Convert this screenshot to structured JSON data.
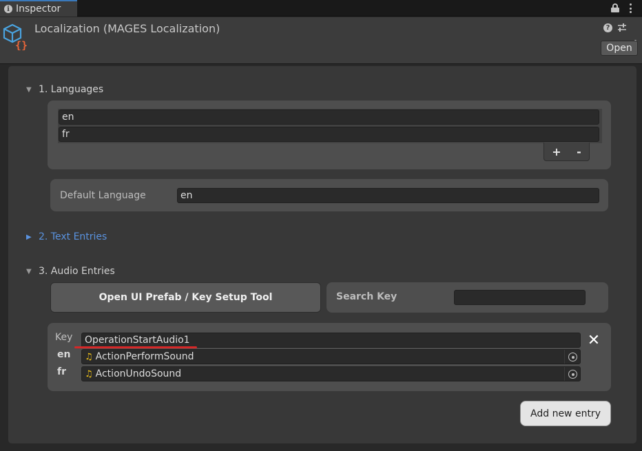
{
  "tab": {
    "title": "Inspector"
  },
  "header": {
    "object_title": "Localization (MAGES Localization)",
    "open_button": "Open",
    "help_glyph": "?"
  },
  "sections": {
    "languages": {
      "title": "1. Languages",
      "items": [
        "en",
        "fr"
      ],
      "add_glyph": "+",
      "remove_glyph": "-",
      "default_language_label": "Default Language",
      "default_language_value": "en"
    },
    "text_entries": {
      "title": "2. Text Entries"
    },
    "audio_entries": {
      "title": "3. Audio Entries",
      "open_tool_button": "Open UI Prefab / Key Setup Tool",
      "search_label": "Search Key",
      "search_value": "",
      "entry": {
        "key_label": "Key",
        "key_value": "OperationStartAudio1",
        "rows": [
          {
            "lang": "en",
            "value": "ActionPerformSound"
          },
          {
            "lang": "fr",
            "value": "ActionUndoSound"
          }
        ],
        "remove_glyph": "✕"
      },
      "add_entry_button": "Add new entry"
    }
  },
  "icons": {
    "tab": "info-icon",
    "lock": "lock-icon",
    "menu": "kebab-menu-icon",
    "object": "localization-cube-icon",
    "help": "help-icon",
    "preset": "preset-sliders-icon",
    "audio": "audio-clip-icon",
    "picker": "object-picker-icon"
  },
  "colors": {
    "accent_tab": "#3a79bb",
    "foldout_collapsed": "#5a93e0",
    "underline": "#d62828",
    "audio_icon": "#f5c518",
    "cube_blue": "#4aa3df",
    "braces_orange": "#e8663a"
  }
}
